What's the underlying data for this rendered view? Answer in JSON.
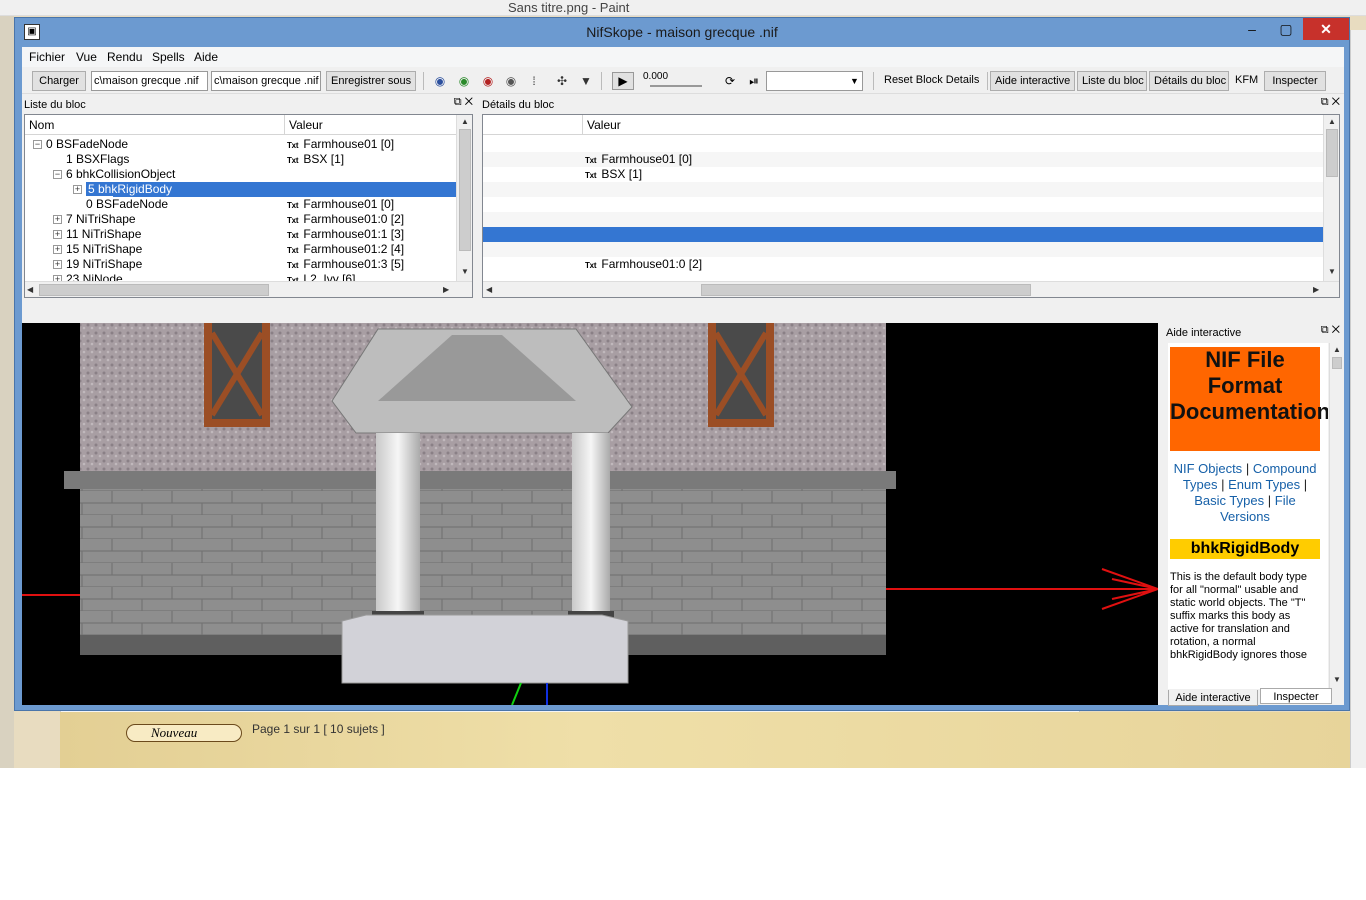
{
  "background": {
    "paint_title": "Sans titre.png - Paint",
    "nouveau_button": "Nouveau",
    "page_count": "Page 1 sur 1   [ 10 sujets ]"
  },
  "window": {
    "title": "NifSkope - maison grecque .nif",
    "minimize": "–",
    "maximize": "▢",
    "close": "✕"
  },
  "menu": [
    "Fichier",
    "Vue",
    "Rendu",
    "Spells",
    "Aide"
  ],
  "toolbar": {
    "load": "Charger",
    "load_path": "c\\maison grecque .nif",
    "save_path": "c\\maison grecque .nif",
    "save": "Enregistrer sous",
    "time_value": "0.000",
    "reset_block_details": "Reset Block Details",
    "help_tab": "Aide interactive",
    "block_list_tab": "Liste du bloc",
    "block_details_tab": "Détails du bloc",
    "kfm_tab": "KFM",
    "inspect_tab": "Inspecter",
    "anim_select": ""
  },
  "block_list": {
    "title": "Liste du bloc",
    "columns": [
      "Nom",
      "Valeur"
    ],
    "rows": [
      {
        "name": "0 BSFadeNode",
        "value": "Farmhouse01 [0]",
        "indent": 0,
        "expander": "−"
      },
      {
        "name": "1 BSXFlags",
        "value": "BSX [1]",
        "indent": 1,
        "expander": ""
      },
      {
        "name": "6 bhkCollisionObject",
        "value": "",
        "indent": 1,
        "expander": "−"
      },
      {
        "name": "5 bhkRigidBody",
        "value": "",
        "indent": 2,
        "expander": "+"
      },
      {
        "name": "0 BSFadeNode",
        "value": "Farmhouse01 [0]",
        "indent": 2,
        "expander": ""
      },
      {
        "name": "7 NiTriShape",
        "value": "Farmhouse01:0 [2]",
        "indent": 1,
        "expander": "+"
      },
      {
        "name": "11 NiTriShape",
        "value": "Farmhouse01:1 [3]",
        "indent": 1,
        "expander": "+"
      },
      {
        "name": "15 NiTriShape",
        "value": "Farmhouse01:2 [4]",
        "indent": 1,
        "expander": "+"
      },
      {
        "name": "19 NiTriShape",
        "value": "Farmhouse01:3 [5]",
        "indent": 1,
        "expander": "+"
      },
      {
        "name": "23 NiNode",
        "value": "L2_Ivy [6]",
        "indent": 1,
        "expander": "+"
      }
    ],
    "txt_badge": "Txt"
  },
  "block_details": {
    "title": "Détails du bloc",
    "columns": [
      "",
      "Valeur"
    ],
    "rows": [
      {
        "value": ""
      },
      {
        "value": "Farmhouse01 [0]"
      },
      {
        "value": "BSX [1]"
      },
      {
        "value": ""
      },
      {
        "value": ""
      },
      {
        "value": ""
      },
      {
        "value": ""
      },
      {
        "value": ""
      },
      {
        "value": "Farmhouse01:0 [2]"
      }
    ]
  },
  "help": {
    "title": "Aide interactive",
    "banner": "NIF File Format Documentation",
    "links": [
      "NIF Objects",
      "Compound Types",
      "Enum Types",
      "Basic Types",
      "File Versions"
    ],
    "class_name": "bhkRigidBody",
    "description": "This is the default body type for all \"normal\" usable and static world objects. The \"T\" suffix marks this body as active for translation and rotation, a normal bhkRigidBody ignores those",
    "tab_help": "Aide interactive",
    "tab_inspect": "Inspecter"
  },
  "colors": {
    "title_bar": "#6c9ad0",
    "selection": "#3476d2",
    "help_banner": "#ff6600",
    "help_class": "#ffcc00",
    "close_button": "#c7312b"
  }
}
